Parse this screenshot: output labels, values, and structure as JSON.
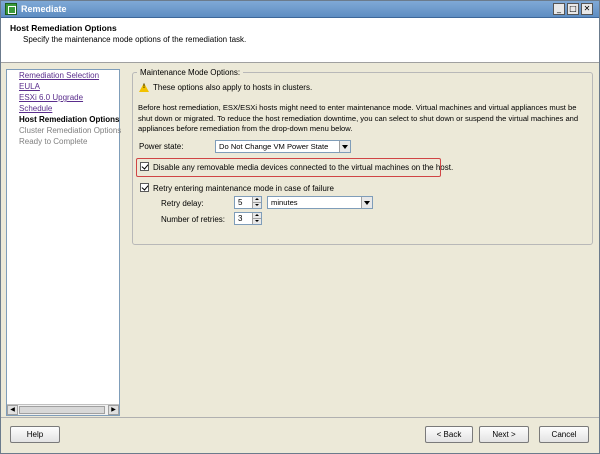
{
  "window": {
    "title": "Remediate"
  },
  "header": {
    "title": "Host Remediation Options",
    "subtitle": "Specify the maintenance mode options of the remediation task."
  },
  "nav": {
    "items": [
      {
        "label": "Remediation Selection",
        "state": "link"
      },
      {
        "label": "EULA",
        "state": "link"
      },
      {
        "label": "ESXi 6.0 Upgrade",
        "state": "link"
      },
      {
        "label": "Schedule",
        "state": "link"
      },
      {
        "label": "Host Remediation Options",
        "state": "current"
      },
      {
        "label": "Cluster Remediation Options",
        "state": "disabled"
      },
      {
        "label": "Ready to Complete",
        "state": "disabled"
      }
    ]
  },
  "options": {
    "legend": "Maintenance Mode Options:",
    "warning": "These options also apply to hosts in clusters.",
    "description": "Before host remediation, ESX/ESXi hosts might need to enter maintenance mode. Virtual machines and virtual appliances must be shut down or migrated. To reduce the host remediation downtime, you can select to shut down or suspend the virtual machines and appliances before remediation from the drop-down menu below.",
    "power_state_label": "Power state:",
    "power_state_value": "Do Not Change VM Power State",
    "disable_media_label": "Disable any removable media devices connected to the virtual machines on the host.",
    "disable_media_checked": true,
    "retry_label": "Retry entering maintenance mode in case of failure",
    "retry_checked": true,
    "retry_delay_label": "Retry delay:",
    "retry_delay_value": "5",
    "retry_delay_unit": "minutes",
    "retries_label": "Number of retries:",
    "retries_value": "3"
  },
  "footer": {
    "help": "Help",
    "back": "< Back",
    "next": "Next >",
    "cancel": "Cancel"
  }
}
